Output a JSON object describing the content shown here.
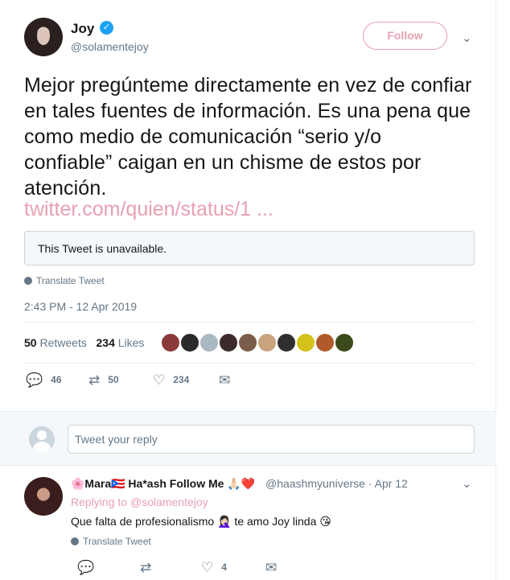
{
  "tweet": {
    "author": {
      "name": "Joy",
      "handle": "@solamentejoy",
      "verified_icon": "verified-badge-icon"
    },
    "follow_label": "Follow",
    "text": "Mejor pregúnteme directamente en vez de confiar en tales fuentes de información. Es una pena que como medio de comunicación “serio y/o confiable” caigan en un chisme de estos por atención.",
    "link": "twitter.com/quien/status/1 ...",
    "quoted_unavailable": "This Tweet is unavailable.",
    "translate_label": "Translate Tweet",
    "timestamp": "2:43 PM - 12 Apr 2019",
    "retweets_count": "50",
    "retweets_label": "Retweets",
    "likes_count": "234",
    "likes_label": "Likes",
    "liker_avatars": [
      "#8b3a3a",
      "#2a2a2a",
      "#aab8c2",
      "#3b2b2b",
      "#7a5c4a",
      "#c9a27e",
      "#2f2f2f",
      "#d4c21a",
      "#b05a2a",
      "#3a4a1a"
    ],
    "actions": {
      "replies": "46",
      "retweets": "50",
      "likes": "234"
    }
  },
  "reply_box": {
    "placeholder": "Tweet your reply"
  },
  "reply": {
    "display_name": "🌸Mara🇵🇷 Ha*ash Follow Me 🙏🏻❤️",
    "handle": "@haashmyuniverse",
    "date": "Apr 12",
    "replying_prefix": "Replying to",
    "replying_to": "@solamentejoy",
    "text": "Que falta de profesionalismo 🤦🏻‍♀️ te amo Joy linda 😘",
    "translate_label": "Translate Tweet",
    "likes": "4"
  },
  "colors": {
    "accent_pink": "#e8a0b2",
    "muted": "#657786",
    "text": "#14171a"
  }
}
